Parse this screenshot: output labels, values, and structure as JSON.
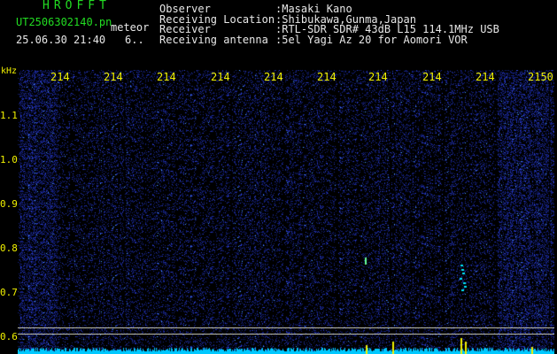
{
  "header": {
    "brand": "HROFFT",
    "filename": "UT2506302140.pn",
    "meteor_label": "meteor",
    "datetime": "25.06.30 21:40",
    "count": "6..",
    "info": [
      {
        "label": "Observer",
        "value": ":Masaki Kano"
      },
      {
        "label": "Receiving Location",
        "value": ":Shibukawa,Gunma,Japan"
      },
      {
        "label": "Receiver",
        "value": ":RTL-SDR SDR# 43dB L15 114.1MHz USB"
      },
      {
        "label": "Receiving antenna",
        "value": ":5el Yagi Az 20 for Aomori VOR"
      }
    ]
  },
  "axes": {
    "unit": "kHz",
    "y_ticks": [
      "1.1",
      "1.0",
      "0.9",
      "0.8",
      "0.7",
      "0.6"
    ],
    "x_ticks": [
      "214",
      "214",
      "214",
      "214",
      "214",
      "214",
      "214",
      "214",
      "214",
      "2150"
    ]
  },
  "colors": {
    "background": "#000000",
    "noise": "#1a2a9a",
    "signal_strong": "#00e5ff",
    "signal_yellow": "#f2f200"
  }
}
